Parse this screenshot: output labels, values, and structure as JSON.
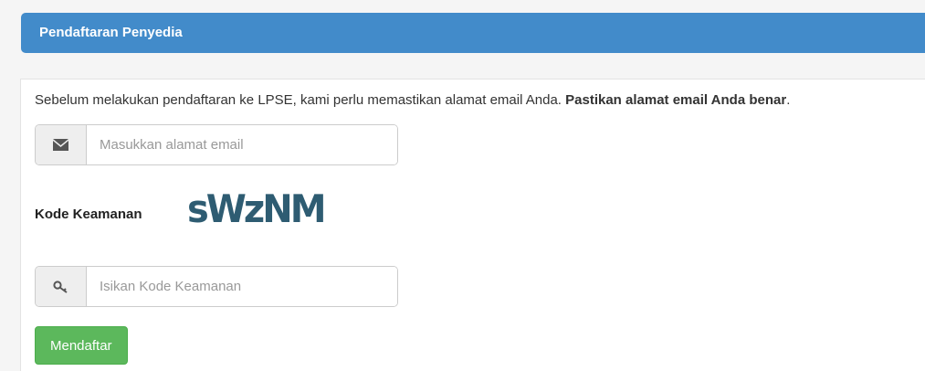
{
  "panel": {
    "title": "Pendaftaran Penyedia"
  },
  "instruction": {
    "text": "Sebelum melakukan pendaftaran ke LPSE, kami perlu memastikan alamat email Anda. ",
    "emphasis": "Pastikan alamat email Anda benar",
    "suffix": "."
  },
  "email": {
    "icon": "envelope-icon",
    "value": "",
    "placeholder": "Masukkan alamat email"
  },
  "captcha": {
    "label": "Kode Keamanan",
    "image_text": "sWzNM"
  },
  "security_code": {
    "icon": "key-icon",
    "value": "",
    "placeholder": "Isikan Kode Keamanan"
  },
  "submit": {
    "label": "Mendaftar"
  },
  "colors": {
    "header": "#428bca",
    "button": "#5cb85c",
    "captcha": "#2e5c72"
  }
}
